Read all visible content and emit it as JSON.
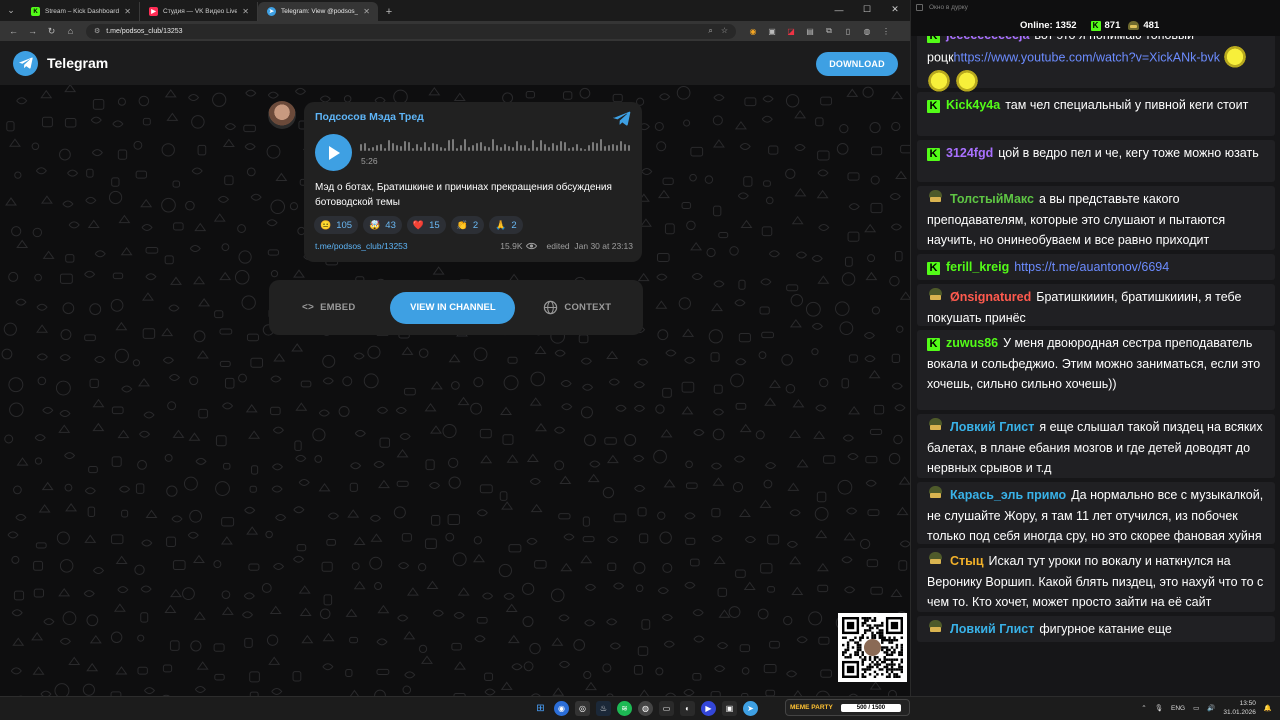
{
  "browser": {
    "tabs": [
      {
        "label": "Stream – Kick Dashboard",
        "favicon": "kick-icon",
        "active": false
      },
      {
        "label": "Студия — VK Видео Live",
        "favicon": "vk-video-icon",
        "active": false
      },
      {
        "label": "Telegram: View @podsos_club",
        "favicon": "telegram-icon",
        "active": true
      }
    ],
    "new_tab": "+",
    "url": "t.me/podsos_club/13253"
  },
  "telegram": {
    "brand": "Telegram",
    "download_label": "DOWNLOAD",
    "post": {
      "channel": "Подсосов Мэда Тред",
      "audio_duration": "5:26",
      "text": "Мэд о ботах, Братишкине и причинах прекращения обсуждения ботоводской темы",
      "reactions": [
        {
          "emoji": "😐",
          "count": "105"
        },
        {
          "emoji": "🤯",
          "count": "43"
        },
        {
          "emoji": "❤️",
          "count": "15"
        },
        {
          "emoji": "👏",
          "count": "2"
        },
        {
          "emoji": "🙏",
          "count": "2"
        }
      ],
      "link": "t.me/podsos_club/13253",
      "views": "15.9K",
      "edited": "edited  Jan 30 at 23:13"
    },
    "actions": {
      "embed": "EMBED",
      "view": "VIEW IN CHANNEL",
      "context": "CONTEXT"
    }
  },
  "chat": {
    "window_title": "Окно в дурку",
    "online_label": "Online:",
    "online_count": "1352",
    "kick_count": "871",
    "vk_count": "481",
    "messages": [
      {
        "platform": "kick",
        "user": "jeeeeeeeeeeja",
        "color": "#a970ff",
        "text": "вот это я понимаю топовый роцк",
        "link": "https://www.youtube.com/watch?v=XickANk-bvk",
        "emotes": 3
      },
      {
        "platform": "kick",
        "user": "Kick4y4a",
        "color": "#53fc18",
        "text": "там чел специальный у пивной кеги стоит"
      },
      {
        "platform": "kick",
        "user": "3124fgd",
        "color": "#a970ff",
        "text": "цой в ведро пел и че, кегу тоже можно юзать"
      },
      {
        "platform": "vk",
        "user": "ТолстыйМакс",
        "color": "#5ec544",
        "text": "а вы представьте какого преподавателям, которые это слушают и пытаются научить, но онинеобуваем и все равно приходит"
      },
      {
        "platform": "kick",
        "user": "ferill_kreig",
        "color": "#53fc18",
        "text": "",
        "link": "https://t.me/auantonov/6694"
      },
      {
        "platform": "vk",
        "user": "Ønsignatured",
        "color": "#ff5a4e",
        "text": "Братишкииин, братишкииин, я тебе покушать принёс"
      },
      {
        "platform": "kick",
        "user": "zuwus86",
        "color": "#53fc18",
        "text": "У меня двоюродная сестра преподаватель вокала и сольфеджио. Этим можно заниматься, если это хочешь, сильно сильно хочешь))"
      },
      {
        "platform": "vk",
        "user": "Ловкий Глист",
        "color": "#39b2e8",
        "text": "я еще слышал такой пиздец на всяких балетах, в плане ебания мозгов и где детей доводят до нервных срывов и т.д"
      },
      {
        "platform": "vk",
        "user": "Карась_эль примо",
        "color": "#39b2e8",
        "text": "Да нормально все с музыкалкой, не слушайте Жору, я там 11 лет отучился, из побочек только под себя иногда сру, но это скорее фановая хуйня"
      },
      {
        "platform": "vk",
        "user": "Стыц",
        "color": "#f2b12a",
        "text": "Искал тут уроки по вокалу и наткнулся на Веронику Воршип. Какой блять пиздец, это нахуй что то с чем то. Кто хочет, может просто зайти на её сайт"
      },
      {
        "platform": "vk",
        "user": "Ловкий Глист",
        "color": "#39b2e8",
        "text": "фигурное катание еще"
      }
    ]
  },
  "taskbar": {
    "widget_logo": "MEME PARTY",
    "widget_progress": "500 / 1500",
    "lang": "ENG",
    "time": "13:50",
    "date": "31.01.2026"
  },
  "colors": {
    "telegram_blue": "#3ea0e3",
    "link_blue": "#5eb5f7",
    "kick_green": "#53fc18"
  }
}
